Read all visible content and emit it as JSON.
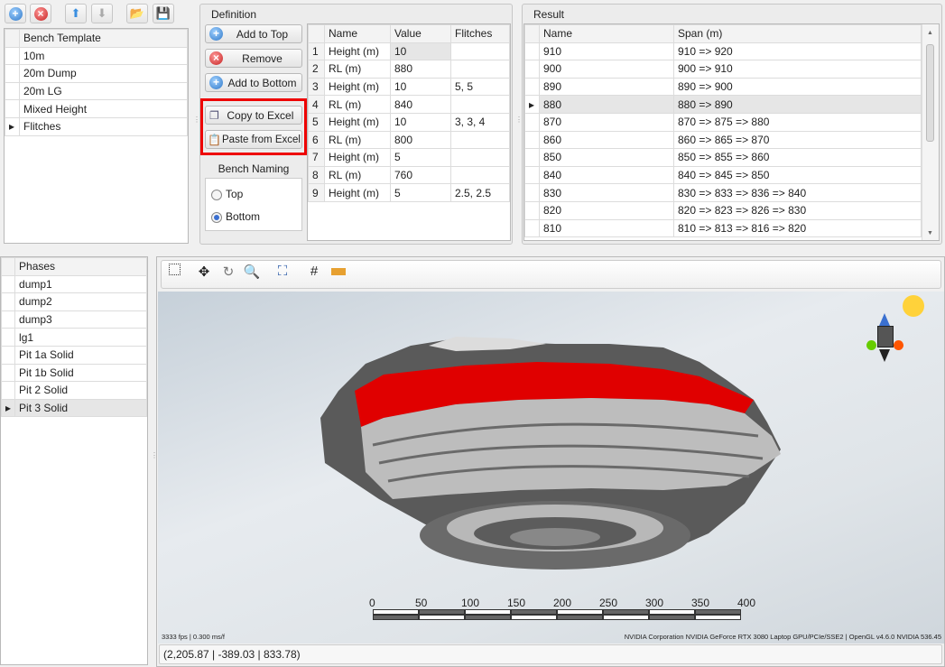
{
  "templates": {
    "toolbar": [
      "add-icon",
      "delete-icon",
      "move-up-icon",
      "move-down-icon",
      "open-folder-icon",
      "save-export-icon"
    ],
    "header": "Bench Template",
    "items": [
      "10m",
      "20m Dump",
      "20m LG",
      "Mixed Height",
      "Flitches"
    ],
    "selected_index": 4
  },
  "definition": {
    "title": "Definition",
    "add_top": "Add to Top",
    "remove": "Remove",
    "add_bottom": "Add to Bottom",
    "copy_excel": "Copy to Excel",
    "paste_excel": "Paste from Excel",
    "bench_naming": "Bench Naming",
    "radio_top": "Top",
    "radio_bottom": "Bottom",
    "selected_naming": "Bottom",
    "columns": [
      "Name",
      "Value",
      "Flitches"
    ],
    "rows": [
      [
        "1",
        "Height (m)",
        "10",
        ""
      ],
      [
        "2",
        "RL (m)",
        "880",
        ""
      ],
      [
        "3",
        "Height (m)",
        "10",
        "5, 5"
      ],
      [
        "4",
        "RL (m)",
        "840",
        ""
      ],
      [
        "5",
        "Height (m)",
        "10",
        "3, 3, 4"
      ],
      [
        "6",
        "RL (m)",
        "800",
        ""
      ],
      [
        "7",
        "Height (m)",
        "5",
        ""
      ],
      [
        "8",
        "RL (m)",
        "760",
        ""
      ],
      [
        "9",
        "Height (m)",
        "5",
        "2.5, 2.5"
      ]
    ]
  },
  "result": {
    "title": "Result",
    "columns": [
      "Name",
      "Span (m)"
    ],
    "rows": [
      [
        "910",
        "910 => 920"
      ],
      [
        "900",
        "900 => 910"
      ],
      [
        "890",
        "890 => 900"
      ],
      [
        "880",
        "880 => 890"
      ],
      [
        "870",
        "870 => 875 => 880"
      ],
      [
        "860",
        "860 => 865 => 870"
      ],
      [
        "850",
        "850 => 855 => 860"
      ],
      [
        "840",
        "840 => 845 => 850"
      ],
      [
        "830",
        "830 => 833 => 836 => 840"
      ],
      [
        "820",
        "820 => 823 => 826 => 830"
      ],
      [
        "810",
        "810 => 813 => 816 => 820"
      ]
    ],
    "selected_index": 3
  },
  "phases": {
    "header": "Phases",
    "items": [
      "dump1",
      "dump2",
      "dump3",
      "lg1",
      "Pit 1a Solid",
      "Pit 1b Solid",
      "Pit 2 Solid",
      "Pit 3 Solid"
    ],
    "selected_index": 7
  },
  "viewer": {
    "tools": [
      "select-box-icon",
      "pan-icon",
      "rotate-icon",
      "zoom-icon",
      "zoom-extents-icon",
      "grid-icon",
      "ruler-icon"
    ],
    "scale_labels": [
      "0",
      "50",
      "100",
      "150",
      "200",
      "250",
      "300",
      "350",
      "400"
    ],
    "fps": "3333 fps | 0.300 ms/f",
    "renderer": "NVIDIA Corporation NVIDIA GeForce RTX 3080 Laptop GPU/PCIe/SSE2 | OpenGL v4.6.0 NVIDIA 536.45",
    "coords": "(2,205.87 | -389.03 | 833.78)",
    "highlight_color": "#e00000"
  }
}
